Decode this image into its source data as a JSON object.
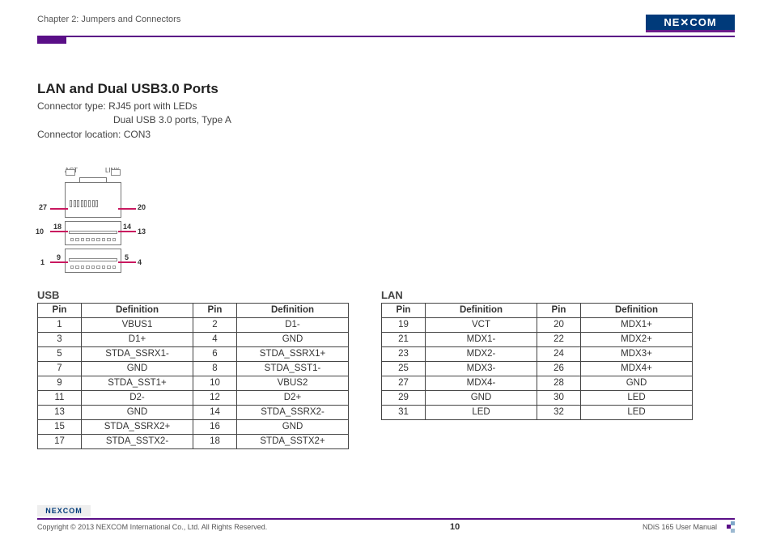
{
  "header": {
    "chapter": "Chapter 2: Jumpers and Connectors",
    "logo_text": "NEXCOM"
  },
  "section": {
    "title": "LAN and Dual USB3.0 Ports",
    "connector_type_label": "Connector type:",
    "connector_type_1": "RJ45 port with LEDs",
    "connector_type_2": "Dual USB 3.0 ports, Type A",
    "connector_location_label": "Connector location:",
    "connector_location": "CON3"
  },
  "diagram": {
    "act": "ACT",
    "link": "LINK",
    "nums": {
      "n1": "1",
      "n4": "4",
      "n5": "5",
      "n9": "9",
      "n10": "10",
      "n13": "13",
      "n14": "14",
      "n18": "18",
      "n20": "20",
      "n27": "27"
    }
  },
  "usb_table": {
    "label": "USB",
    "headers": {
      "pin": "Pin",
      "def": "Definition"
    },
    "rows": [
      {
        "p1": "1",
        "d1": "VBUS1",
        "p2": "2",
        "d2": "D1-"
      },
      {
        "p1": "3",
        "d1": "D1+",
        "p2": "4",
        "d2": "GND"
      },
      {
        "p1": "5",
        "d1": "STDA_SSRX1-",
        "p2": "6",
        "d2": "STDA_SSRX1+"
      },
      {
        "p1": "7",
        "d1": "GND",
        "p2": "8",
        "d2": "STDA_SST1-"
      },
      {
        "p1": "9",
        "d1": "STDA_SST1+",
        "p2": "10",
        "d2": "VBUS2"
      },
      {
        "p1": "11",
        "d1": "D2-",
        "p2": "12",
        "d2": "D2+"
      },
      {
        "p1": "13",
        "d1": "GND",
        "p2": "14",
        "d2": "STDA_SSRX2-"
      },
      {
        "p1": "15",
        "d1": "STDA_SSRX2+",
        "p2": "16",
        "d2": "GND"
      },
      {
        "p1": "17",
        "d1": "STDA_SSTX2-",
        "p2": "18",
        "d2": "STDA_SSTX2+"
      }
    ]
  },
  "lan_table": {
    "label": "LAN",
    "headers": {
      "pin": "Pin",
      "def": "Definition"
    },
    "rows": [
      {
        "p1": "19",
        "d1": "VCT",
        "p2": "20",
        "d2": "MDX1+"
      },
      {
        "p1": "21",
        "d1": "MDX1-",
        "p2": "22",
        "d2": "MDX2+"
      },
      {
        "p1": "23",
        "d1": "MDX2-",
        "p2": "24",
        "d2": "MDX3+"
      },
      {
        "p1": "25",
        "d1": "MDX3-",
        "p2": "26",
        "d2": "MDX4+"
      },
      {
        "p1": "27",
        "d1": "MDX4-",
        "p2": "28",
        "d2": "GND"
      },
      {
        "p1": "29",
        "d1": "GND",
        "p2": "30",
        "d2": "LED"
      },
      {
        "p1": "31",
        "d1": "LED",
        "p2": "32",
        "d2": "LED"
      }
    ]
  },
  "footer": {
    "logo_text": "NEXCOM",
    "copyright": "Copyright © 2013 NEXCOM International Co., Ltd. All Rights Reserved.",
    "page": "10",
    "manual": "NDiS 165 User Manual"
  }
}
